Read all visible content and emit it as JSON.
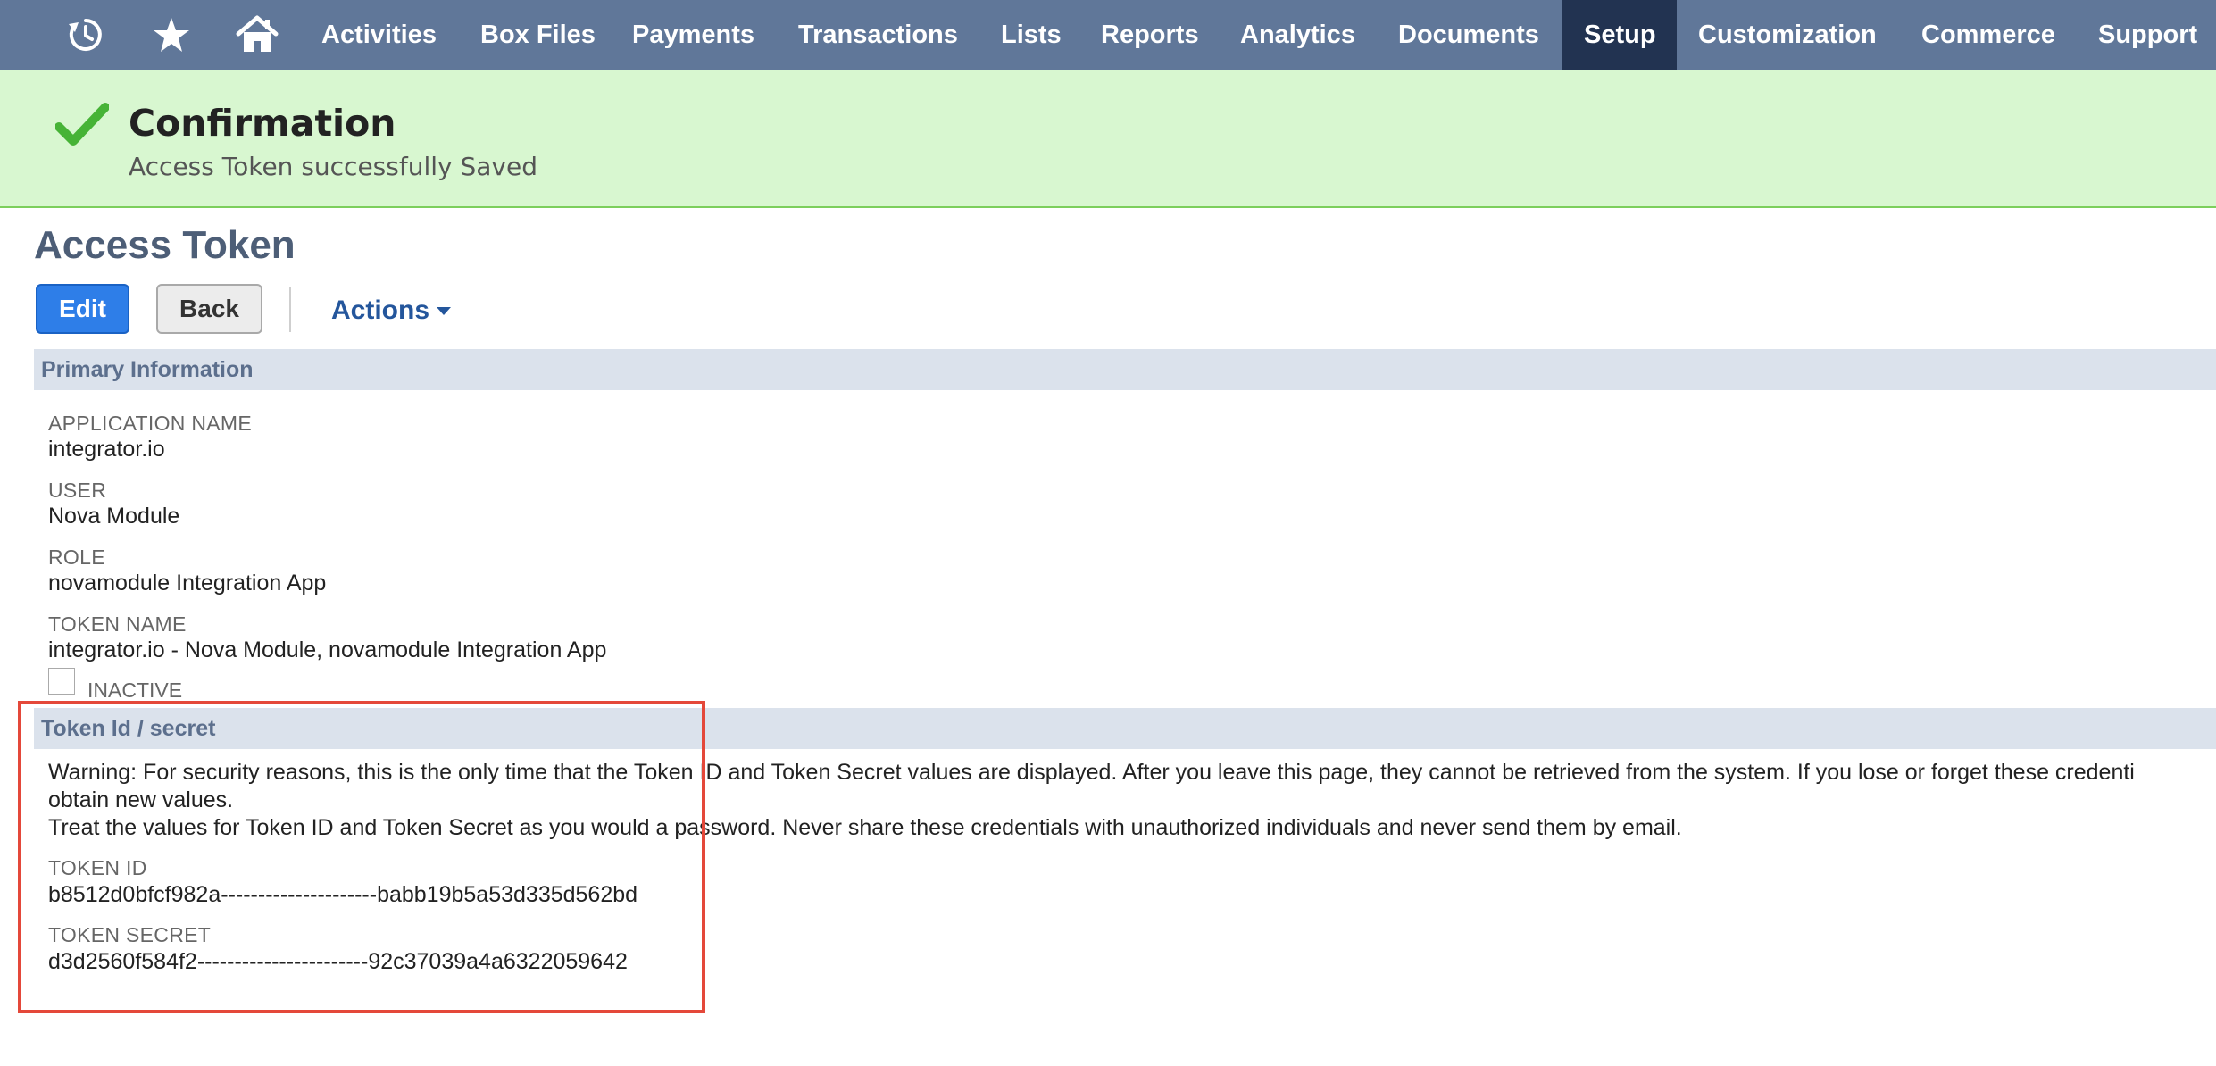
{
  "nav": {
    "items": [
      {
        "label": "Activities"
      },
      {
        "label": "Box Files"
      },
      {
        "label": "Payments"
      },
      {
        "label": "Transactions"
      },
      {
        "label": "Lists"
      },
      {
        "label": "Reports"
      },
      {
        "label": "Analytics"
      },
      {
        "label": "Documents"
      },
      {
        "label": "Setup",
        "active": true
      },
      {
        "label": "Customization"
      },
      {
        "label": "Commerce"
      },
      {
        "label": "Support"
      }
    ],
    "icons": [
      "recent-history-icon",
      "star-icon",
      "home-icon"
    ]
  },
  "confirmation": {
    "title": "Confirmation",
    "message": "Access Token successfully Saved"
  },
  "page": {
    "title": "Access Token",
    "edit_label": "Edit",
    "back_label": "Back",
    "actions_label": "Actions"
  },
  "primary": {
    "header": "Primary Information",
    "application_name_label": "APPLICATION NAME",
    "application_name": "integrator.io",
    "user_label": "USER",
    "user": "Nova Module",
    "role_label": "ROLE",
    "role": "novamodule Integration App",
    "token_name_label": "TOKEN NAME",
    "token_name": "integrator.io - Nova Module, novamodule Integration App",
    "inactive_label": "INACTIVE",
    "inactive_checked": false
  },
  "token": {
    "header": "Token Id / secret",
    "warning_line1": "Warning: For security reasons, this is the only time that the Token ID and Token Secret values are displayed. After you leave this page, they cannot be retrieved from the system. If you lose or forget these credenti",
    "warning_line2": "obtain new values.",
    "warning_line3": "Treat the values for Token ID and Token Secret as you would a password. Never share these credentials with unauthorized individuals and never send them by email.",
    "token_id_label": "TOKEN ID",
    "token_id": "b8512d0bfcf982a---------------------babb19b5a53d335d562bd",
    "token_secret_label": "TOKEN SECRET",
    "token_secret": "d3d2560f584f2-----------------------92c37039a4a6322059642"
  },
  "colors": {
    "nav_bg": "#607799",
    "nav_active": "#223351",
    "confirm_bg": "#d8f7d0",
    "primary_button": "#2e7ee8",
    "highlight_border": "#e4483a"
  }
}
